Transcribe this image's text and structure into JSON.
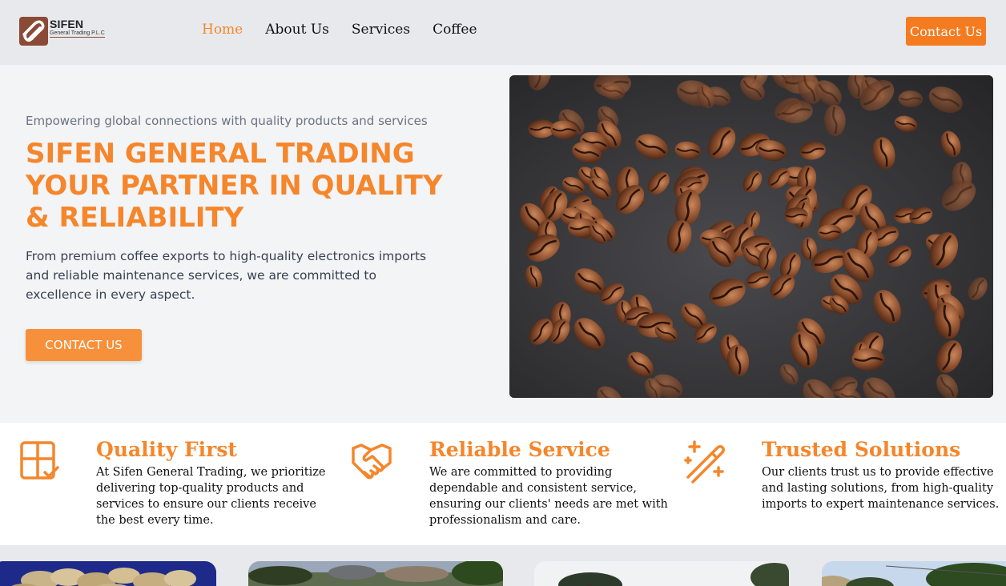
{
  "header": {
    "logo_name": "SIFEN",
    "logo_sub": "General Trading P.L.C",
    "nav": [
      {
        "label": "Home",
        "active": true
      },
      {
        "label": "About Us",
        "active": false
      },
      {
        "label": "Services",
        "active": false
      },
      {
        "label": "Coffee",
        "active": false
      }
    ],
    "cta_label": "Contact Us"
  },
  "hero": {
    "tagline": "Empowering global connections with quality products and services",
    "title": "SIFEN GENERAL TRADING YOUR PARTNER IN QUALITY & RELIABILITY",
    "description": "From premium coffee exports to high-quality electronics imports and reliable maintenance services, we are committed to excellence in every aspect.",
    "cta_label": "CONTACT US",
    "image": "coffee-beans-photo"
  },
  "features": [
    {
      "icon": "quality-grid-check-icon",
      "title": "Quality First",
      "text": "At Sifen General Trading, we prioritize delivering top-quality products and services to ensure our clients receive the best every time."
    },
    {
      "icon": "handshake-icon",
      "title": "Reliable Service",
      "text": "We are committed to providing dependable and consistent service, ensuring our clients' needs are met with professionalism and care."
    },
    {
      "icon": "magic-wand-icon",
      "title": "Trusted Solutions",
      "text": "Our clients trust us to provide effective and lasting solutions, from high-quality imports to expert maintenance services."
    }
  ],
  "gallery": [
    "coffee-beans-thumb",
    "farm-landscape-thumb",
    "trees-sky-thumb",
    "roadside-trees-thumb"
  ],
  "colors": {
    "accent": "#f5862b",
    "button": "#f47b20",
    "header_bg": "#e8e9ec",
    "page_bg": "#f3f4f6"
  }
}
